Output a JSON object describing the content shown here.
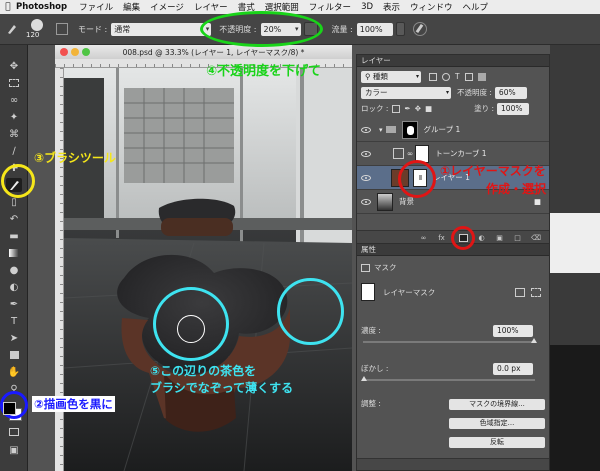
{
  "menubar": {
    "app_name": "Photoshop",
    "items": [
      "ファイル",
      "編集",
      "イメージ",
      "レイヤー",
      "書式",
      "選択範囲",
      "フィルター",
      "3D",
      "表示",
      "ウィンドウ",
      "ヘルプ"
    ]
  },
  "options_bar": {
    "brush_size": "120",
    "mode_label": "モード :",
    "mode_value": "通常",
    "opacity_label": "不透明度 :",
    "opacity_value": "20%",
    "flow_label": "流量 :",
    "flow_value": "100%"
  },
  "document": {
    "title": "008.psd @ 33.3% (レイヤー 1, レイヤーマスク/8) *"
  },
  "layers_panel": {
    "tab": "レイヤー",
    "filter_value": "種類",
    "blend_mode": "カラー",
    "opacity_label": "不透明度 :",
    "opacity_value": "60%",
    "lock_label": "ロック :",
    "fill_label": "塗り :",
    "fill_value": "100%",
    "layers": [
      {
        "name": "グループ 1"
      },
      {
        "name": "トーンカーブ 1"
      },
      {
        "name": "レイヤー 1"
      },
      {
        "name": "背景"
      }
    ]
  },
  "properties_panel": {
    "tab": "属性",
    "mask_header": "マスク",
    "mask_type": "レイヤーマスク",
    "density_label": "濃度 :",
    "density_value": "100%",
    "feather_label": "ぼかし :",
    "feather_value": "0.0 px",
    "adjust_label": "調整 :",
    "btn_mask_edge": "マスクの境界線...",
    "btn_color_range": "色域指定...",
    "btn_invert": "反転"
  },
  "annotations": {
    "step2": "②描画色を黒に",
    "step3": "③ブラシツール",
    "step4": "④不透明度を下げて",
    "step1_line1": "①レイヤーマスクを",
    "step1_line2": "作成・選択",
    "step5_line1": "⑤この辺りの茶色を",
    "step5_line2": "ブラシでなぞって薄くする",
    "colors": {
      "yellow": "#f5e61a",
      "red": "#e01515",
      "green": "#19d419",
      "cyan": "#3ee3f0",
      "blue": "#1a1aff"
    }
  }
}
